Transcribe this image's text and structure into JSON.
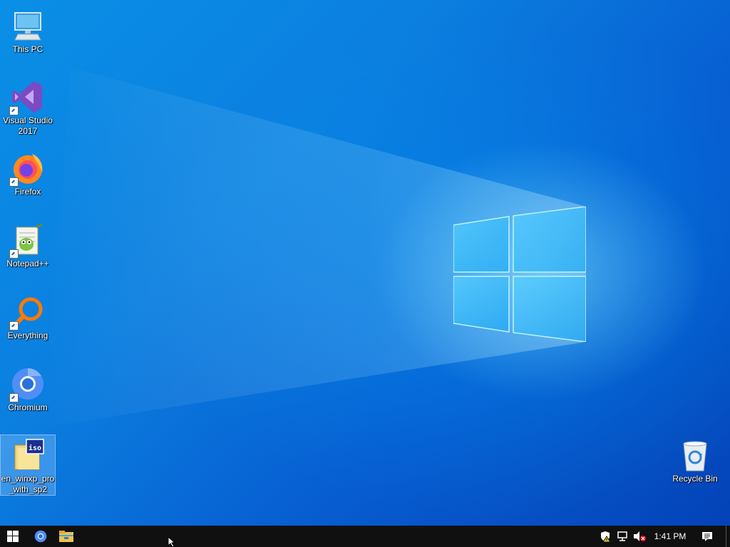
{
  "desktop": {
    "icons": [
      {
        "label": "This PC",
        "icon": "computer-icon"
      },
      {
        "label": "Visual Studio 2017",
        "icon": "visual-studio-icon"
      },
      {
        "label": "Firefox",
        "icon": "firefox-icon"
      },
      {
        "label": "Notepad++",
        "icon": "notepad-plus-plus-icon"
      },
      {
        "label": "Everything",
        "icon": "everything-search-icon"
      },
      {
        "label": "Chromium",
        "icon": "chromium-icon"
      },
      {
        "label": "en_winxp_pro_with_sp2",
        "icon": "iso-file-icon",
        "selected": true
      },
      {
        "label": "Recycle Bin",
        "icon": "recycle-bin-icon"
      }
    ]
  },
  "taskbar": {
    "pinned": [
      {
        "name": "Start",
        "icon": "windows-start-icon"
      },
      {
        "name": "Chromium",
        "icon": "chromium-icon"
      },
      {
        "name": "File Explorer",
        "icon": "folder-icon"
      }
    ],
    "tray": {
      "icons": [
        "security-shield-icon",
        "network-icon",
        "volume-muted-icon"
      ],
      "clock": "1:41 PM",
      "notifications_icon": "action-center-icon"
    }
  },
  "colors": {
    "wallpaper_accent": "#0b7fe0",
    "taskbar": "#101010",
    "logo_glow": "#8ee8ff"
  }
}
